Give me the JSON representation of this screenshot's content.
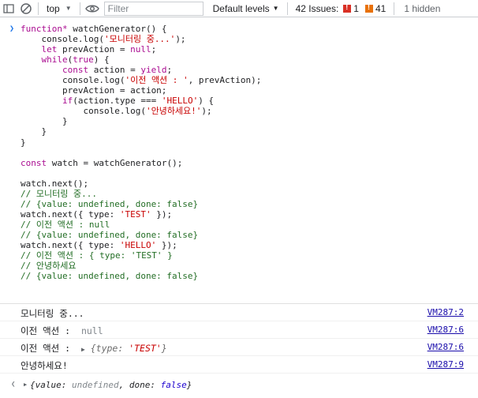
{
  "toolbar": {
    "context": "top",
    "filter_placeholder": "Filter",
    "levels_label": "Default levels",
    "issues_label": "42 Issues:",
    "error_count": "1",
    "warning_count": "41",
    "hidden_label": "1 hidden"
  },
  "code": {
    "lines": [
      "function* watchGenerator() {",
      "    console.log('모니터링 중...');",
      "    let prevAction = null;",
      "    while(true) {",
      "        const action = yield;",
      "        console.log('이전 액션 : ', prevAction);",
      "        prevAction = action;",
      "        if(action.type === 'HELLO') {",
      "            console.log('안녕하세요!');",
      "        }",
      "    }",
      "}",
      "",
      "const watch = watchGenerator();",
      "",
      "watch.next();",
      "// 모니터링 중...",
      "// {value: undefined, done: false}",
      "watch.next({ type: 'TEST' });",
      "// 이전 액션 : null",
      "// {value: undefined, done: false}",
      "watch.next({ type: 'HELLO' });",
      "// 이전 액션 : { type: 'TEST' }",
      "// 안녕하세요",
      "// {value: undefined, done: false}"
    ]
  },
  "logs": [
    {
      "text": "모니터링 중...",
      "extra": "",
      "source": "VM287:2"
    },
    {
      "text": "이전 액션 : ",
      "extra": "null",
      "source": "VM287:6"
    },
    {
      "text": "이전 액션 : ",
      "extra": "{type: 'TEST'}",
      "source": "VM287:6"
    },
    {
      "text": "안녕하세요!",
      "extra": "",
      "source": "VM287:9"
    }
  ],
  "result": {
    "open": "{",
    "value_key": "value: ",
    "value_val": "undefined",
    "sep": ", ",
    "done_key": "done: ",
    "done_val": "false",
    "close": "}"
  },
  "colors": {
    "link": "#1a0dab",
    "keyword": "#aa0d91",
    "string": "#c80000",
    "comment": "#236e25",
    "error_badge": "#d93025",
    "warning_badge": "#e8710a"
  }
}
